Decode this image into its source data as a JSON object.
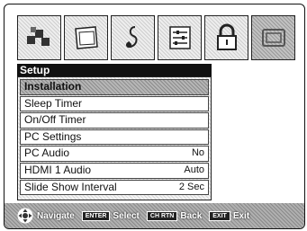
{
  "icon_tabs": [
    {
      "icon": "picture-icon",
      "active": false
    },
    {
      "icon": "screen-icon",
      "active": false
    },
    {
      "icon": "audio-note-icon",
      "active": false
    },
    {
      "icon": "settings-sliders-icon",
      "active": false
    },
    {
      "icon": "lock-icon",
      "active": false
    },
    {
      "icon": "setup-icon",
      "active": true
    }
  ],
  "menu": {
    "title": "Setup",
    "items": [
      {
        "label": "Installation",
        "value": "",
        "selected": true
      },
      {
        "label": "Sleep Timer",
        "value": ""
      },
      {
        "label": "On/Off Timer",
        "value": ""
      },
      {
        "label": "PC Settings",
        "value": ""
      },
      {
        "label": "PC Audio",
        "value": "No"
      },
      {
        "label": "HDMI 1 Audio",
        "value": "Auto"
      },
      {
        "label": "Slide Show Interval",
        "value": "2 Sec"
      }
    ]
  },
  "footer": {
    "navigate_label": "Navigate",
    "enter_key": "ENTER",
    "select_label": "Select",
    "ch_rtn_key": "CH RTN",
    "back_label": "Back",
    "exit_key": "EXIT",
    "exit_label": "Exit"
  }
}
